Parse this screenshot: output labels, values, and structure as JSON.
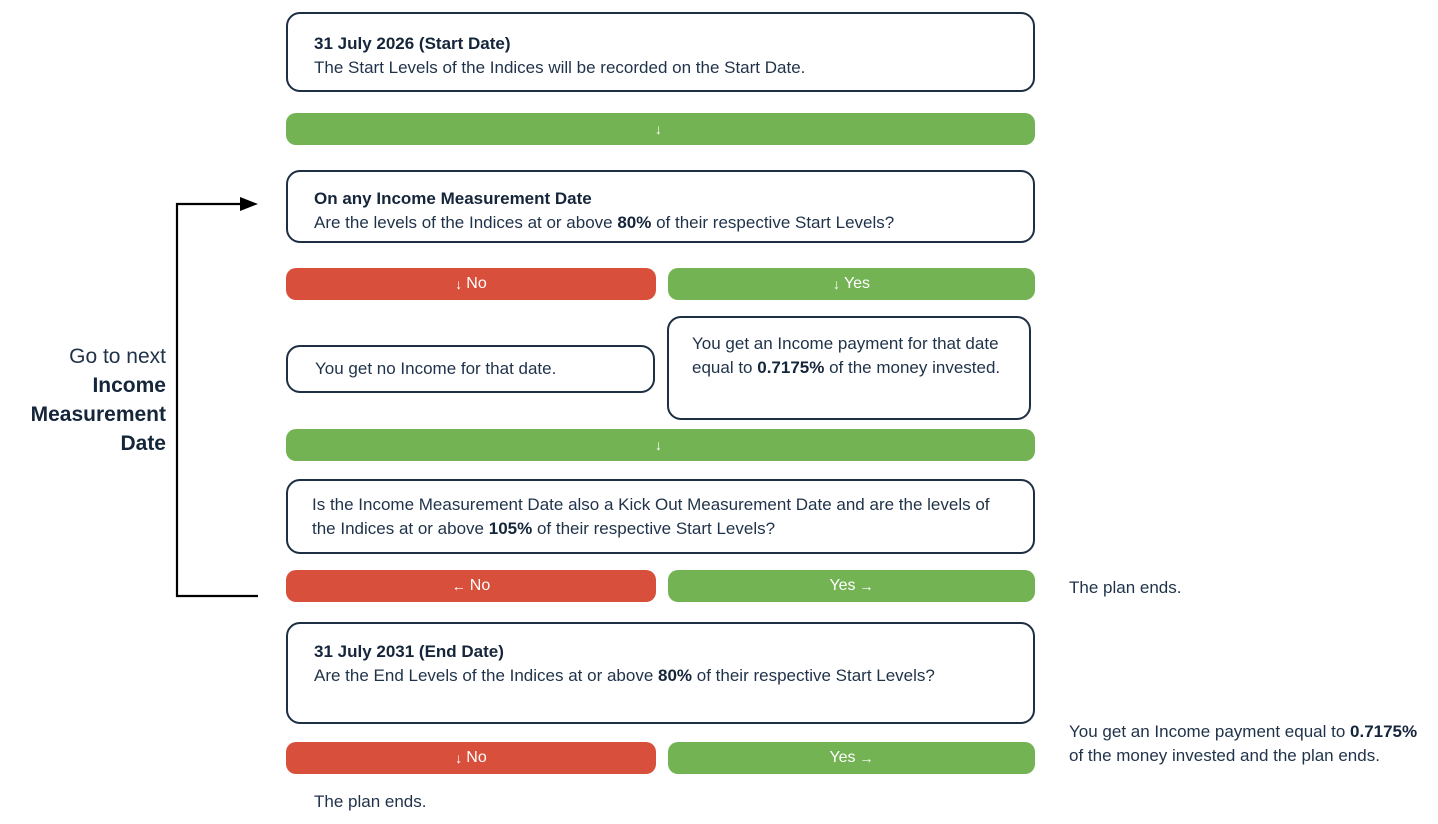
{
  "start_box": {
    "title": "31 July 2026 (Start Date)",
    "text": "The Start Levels of the Indices will be recorded on the Start Date."
  },
  "bar1": {
    "arrow": "↓"
  },
  "income_box": {
    "title": "On any Income Measurement Date",
    "text_pre": "Are the levels of the Indices at or above ",
    "bold": "80%",
    "text_post": " of their respective Start Levels?"
  },
  "income_choice": {
    "no": {
      "arrow": "↓",
      "label": "No"
    },
    "yes": {
      "arrow": "↓",
      "label": "Yes"
    }
  },
  "no_income_box": {
    "text": "You get no Income for that date."
  },
  "yes_income_box": {
    "text_pre": "You get an Income payment for that date equal to ",
    "bold": "0.7175%",
    "text_post": " of the money invested."
  },
  "bar2": {
    "arrow": "↓"
  },
  "kickout_box": {
    "text_pre": "Is the Income Measurement Date also a Kick Out Measurement Date and are the levels of the Indices at or above ",
    "bold": "105%",
    "text_post": " of their respective Start Levels?"
  },
  "kickout_choice": {
    "no": {
      "arrow": "←",
      "label": "No"
    },
    "yes": {
      "label": "Yes",
      "arrow": "→"
    }
  },
  "kickout_yes_result": "The plan ends.",
  "side_label": {
    "line1": "Go to next",
    "bold": "Income Measurement Date"
  },
  "end_box": {
    "title": "31 July 2031 (End Date)",
    "text_pre": "Are the End Levels of the Indices at or above ",
    "bold": "80%",
    "text_post": " of their respective Start Levels?"
  },
  "end_choice": {
    "no": {
      "arrow": "↓",
      "label": "No"
    },
    "yes": {
      "label": "Yes",
      "arrow": "→"
    }
  },
  "end_no_result": "The plan ends.",
  "end_yes_result": {
    "text_pre": "You get an Income payment equal to ",
    "bold": "0.7175%",
    "text_post": " of the money invested and the plan ends."
  },
  "colors": {
    "yes": "#74b354",
    "no": "#d8503b",
    "border": "#1e2f44",
    "text": "#1f3249"
  }
}
